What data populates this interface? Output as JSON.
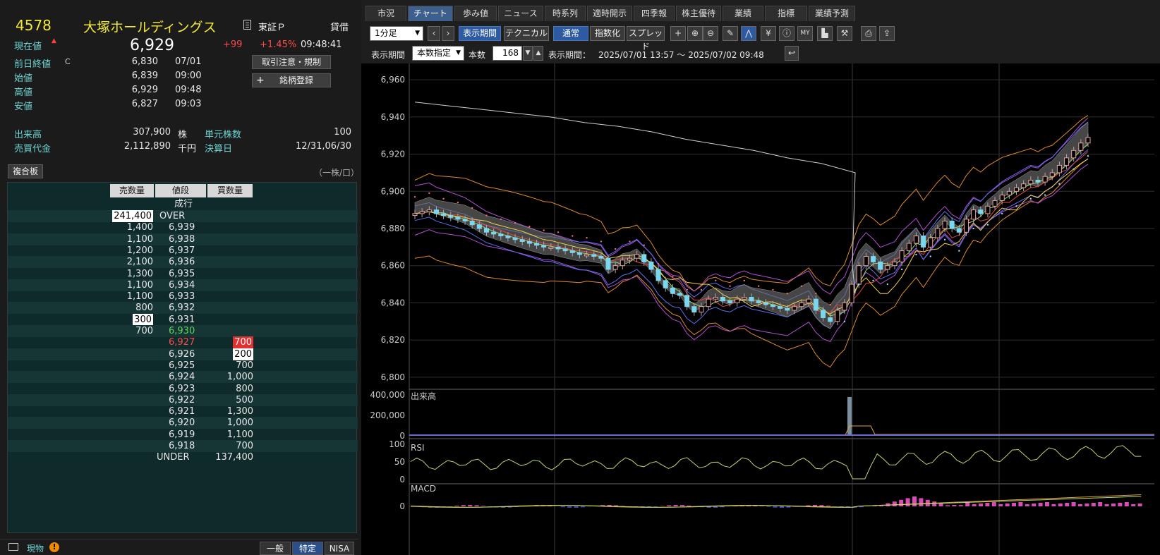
{
  "header": {
    "code": "4578",
    "name": "大塚ホールディングス",
    "market": "東証Ｐ",
    "margin": "貸借",
    "current_label": "現在値",
    "price": "6,929",
    "change": "+99",
    "change_pct": "+1.45%",
    "time": "09:48:41"
  },
  "buttons": {
    "notice": "取引注意・規制",
    "register": "銘柄登録",
    "composite": "複合板"
  },
  "info": [
    {
      "label": "前日終値",
      "flag": "C",
      "value": "6,830",
      "time": "07/01"
    },
    {
      "label": "始値",
      "flag": "",
      "value": "6,839",
      "time": "09:00"
    },
    {
      "label": "高値",
      "flag": "",
      "value": "6,929",
      "time": "09:48"
    },
    {
      "label": "安値",
      "flag": "",
      "value": "6,827",
      "time": "09:03"
    }
  ],
  "volume": {
    "vol_label": "出来高",
    "vol_value": "307,900",
    "vol_unit": "株",
    "unit_label": "単元株数",
    "unit_value": "100",
    "turnover_label": "売買代金",
    "turnover_value": "2,112,890",
    "turnover_unit": "千円",
    "settle_label": "決算日",
    "settle_value": "12/31,06/30"
  },
  "unit_note": "（一株/口）",
  "book": {
    "headers": [
      "売数量",
      "値段",
      "買数量"
    ],
    "market_order": "成行",
    "rows": [
      {
        "sell": "241,400",
        "price": "OVER",
        "buy": "",
        "sell_hl": "w"
      },
      {
        "sell": "1,400",
        "price": "6,939",
        "buy": ""
      },
      {
        "sell": "1,100",
        "price": "6,938",
        "buy": ""
      },
      {
        "sell": "1,200",
        "price": "6,937",
        "buy": ""
      },
      {
        "sell": "2,100",
        "price": "6,936",
        "buy": ""
      },
      {
        "sell": "1,300",
        "price": "6,935",
        "buy": ""
      },
      {
        "sell": "1,100",
        "price": "6,934",
        "buy": ""
      },
      {
        "sell": "1,100",
        "price": "6,933",
        "buy": ""
      },
      {
        "sell": "800",
        "price": "6,932",
        "buy": ""
      },
      {
        "sell": "300",
        "price": "6,931",
        "buy": "",
        "sell_hl": "w"
      },
      {
        "sell": "700",
        "price": "6,930",
        "buy": "",
        "color": "#5fd35f"
      },
      {
        "sell": "",
        "price": "6,927",
        "buy": "700",
        "color": "#ff4a4a",
        "buy_hl": "r"
      },
      {
        "sell": "",
        "price": "6,926",
        "buy": "200",
        "buy_hl": "w"
      },
      {
        "sell": "",
        "price": "6,925",
        "buy": "700"
      },
      {
        "sell": "",
        "price": "6,924",
        "buy": "1,000"
      },
      {
        "sell": "",
        "price": "6,923",
        "buy": "800"
      },
      {
        "sell": "",
        "price": "6,922",
        "buy": "500"
      },
      {
        "sell": "",
        "price": "6,921",
        "buy": "1,300"
      },
      {
        "sell": "",
        "price": "6,920",
        "buy": "1,000"
      },
      {
        "sell": "",
        "price": "6,919",
        "buy": "1,100"
      },
      {
        "sell": "",
        "price": "6,918",
        "buy": "700"
      },
      {
        "sell": "",
        "price": "UNDER",
        "buy": "137,400"
      }
    ]
  },
  "footer": {
    "spot": "現物",
    "tabs": [
      "一般",
      "特定",
      "NISA"
    ],
    "active_tab": "特定"
  },
  "tabs": [
    "市況",
    "チャート",
    "歩み値",
    "ニュース",
    "時系列",
    "適時開示",
    "四季報",
    "株主優待",
    "業績",
    "指標",
    "業績予測"
  ],
  "active_tab": "チャート",
  "toolbar": {
    "interval": "1分足",
    "period_btn": "表示期間",
    "technical_btn": "テクニカル",
    "normal_btn": "通常",
    "index_btn": "指数化",
    "spread_btn": "スプレッド",
    "period_label": "表示期間",
    "period_mode": "本数指定",
    "count_label": "本数",
    "count": "168",
    "range_label": "表示期間：",
    "range": "2025/07/01 13:57 ～ 2025/07/02 09:48"
  },
  "icons": [
    "crosshair-icon",
    "zoom-in-icon",
    "zoom-out-icon",
    "pencil-icon",
    "line-draw-icon",
    "yen-icon",
    "info-icon",
    "my-icon",
    "volume-profile-icon",
    "wrench-icon",
    "print-icon",
    "export-icon",
    "reset-icon"
  ],
  "chart_data": {
    "type": "line",
    "title": "",
    "price_axis": {
      "ticks": [
        6960,
        6940,
        6920,
        6900,
        6880,
        6860,
        6840,
        6820,
        6800
      ],
      "ylim": [
        6795,
        6965
      ]
    },
    "volume_panel": {
      "label": "出来高",
      "ticks": [
        400000,
        200000,
        0
      ],
      "spike": 380000
    },
    "rsi_panel": {
      "label": "RSI",
      "ticks": [
        100,
        50,
        0
      ]
    },
    "macd_panel": {
      "label": "MACD",
      "ticks": [
        0
      ]
    },
    "candles_close": [
      6888,
      6889,
      6890,
      6888,
      6887,
      6886,
      6885,
      6884,
      6882,
      6880,
      6878,
      6877,
      6876,
      6875,
      6874,
      6873,
      6872,
      6871,
      6870,
      6870,
      6869,
      6868,
      6867,
      6866,
      6866,
      6865,
      6864,
      6858,
      6860,
      6863,
      6864,
      6866,
      6862,
      6858,
      6852,
      6848,
      6845,
      6844,
      6838,
      6835,
      6838,
      6842,
      6843,
      6841,
      6840,
      6842,
      6843,
      6841,
      6840,
      6839,
      6838,
      6837,
      6836,
      6838,
      6840,
      6842,
      6836,
      6832,
      6830,
      6836,
      6840,
      6850,
      6860,
      6865,
      6862,
      6858,
      6860,
      6862,
      6868,
      6872,
      6876,
      6870,
      6875,
      6880,
      6884,
      6880,
      6878,
      6885,
      6890,
      6888,
      6892,
      6895,
      6898,
      6900,
      6902,
      6904,
      6906,
      6905,
      6908,
      6910,
      6914,
      6918,
      6922,
      6926,
      6929
    ],
    "upper_line": [
      6948,
      6946,
      6944,
      6942,
      6940,
      6937,
      6935,
      6932,
      6928,
      6925,
      6922,
      6918,
      6915,
      6910
    ],
    "volume_spike_index": 45
  }
}
